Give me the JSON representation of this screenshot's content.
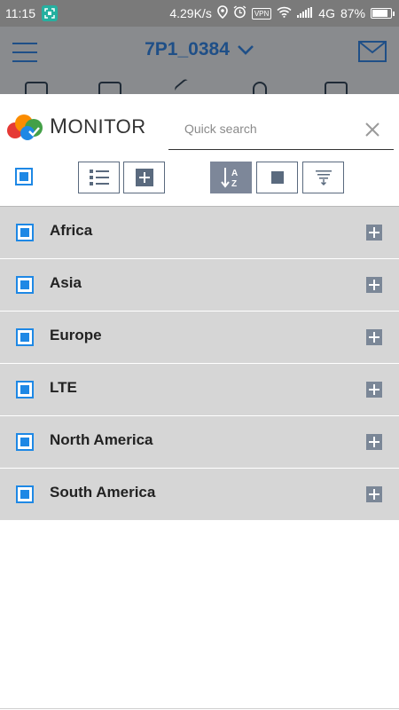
{
  "status_bar": {
    "time": "11:15",
    "network_speed": "4.29K/s",
    "vpn": "VPN",
    "network_type": "4G",
    "battery": "87%",
    "battery_level": 0.87
  },
  "header": {
    "device_name": "7P1_0384"
  },
  "monitor_panel": {
    "logo_first": "M",
    "logo_rest": "ONITOR",
    "search": {
      "placeholder": "Quick search",
      "value": ""
    }
  },
  "groups": [
    {
      "label": "Africa"
    },
    {
      "label": "Asia"
    },
    {
      "label": "Europe"
    },
    {
      "label": "LTE"
    },
    {
      "label": "North America"
    },
    {
      "label": "South America"
    }
  ],
  "colors": {
    "accent_blue": "#1e88e5",
    "header_blue": "#1f4f87",
    "row_background": "#d6d6d6",
    "button_gray": "#7b8797"
  }
}
